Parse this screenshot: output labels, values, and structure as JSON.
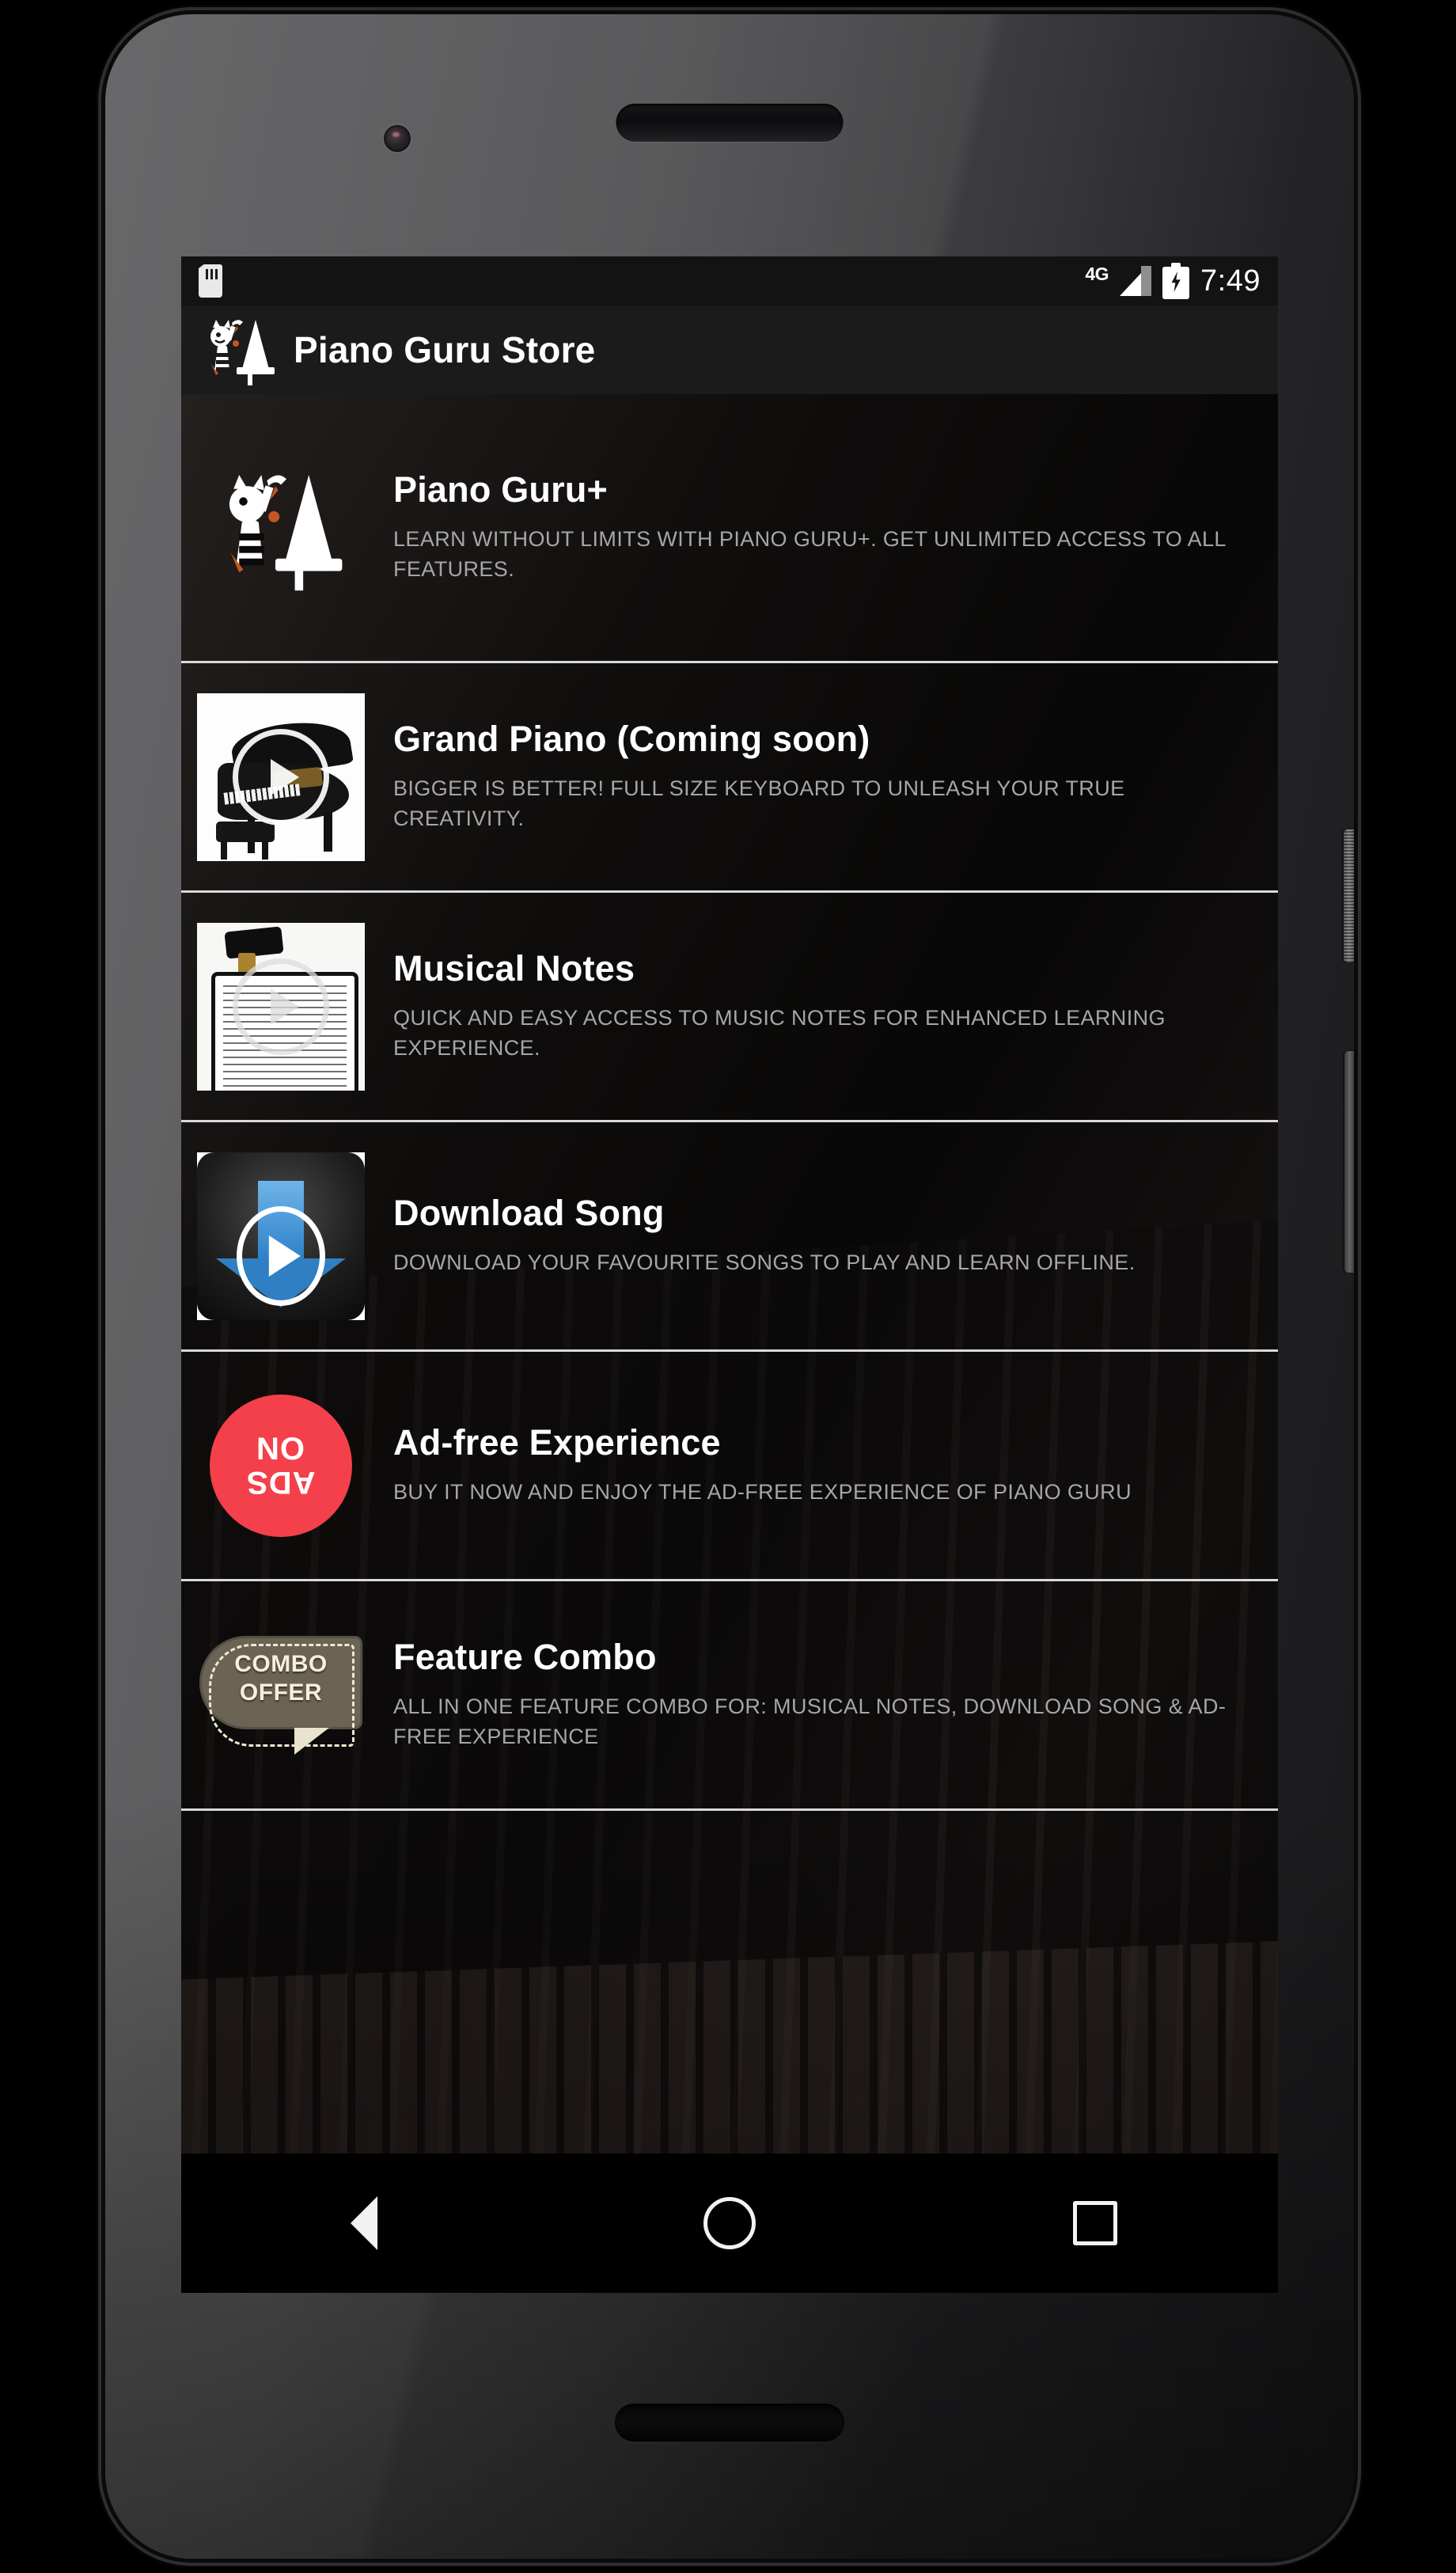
{
  "status_bar": {
    "sim_icon": "sim-card-icon",
    "network_label": "4G",
    "signal_icon": "signal-bars-icon",
    "battery_icon": "battery-charging-icon",
    "clock": "7:49"
  },
  "action_bar": {
    "logo_icon": "piano-guru-logo-icon",
    "title": "Piano Guru Store"
  },
  "store_items": [
    {
      "title": "Piano Guru+",
      "description": "LEARN WITHOUT LIMITS WITH PIANO GURU+. GET UNLIMITED ACCESS TO ALL FEATURES.",
      "thumb": "piano-guru-logo-icon"
    },
    {
      "title": "Grand Piano (Coming soon)",
      "description": "BIGGER IS BETTER! FULL SIZE KEYBOARD TO UNLEASH YOUR TRUE CREATIVITY.",
      "thumb": "grand-piano-video-thumbnail"
    },
    {
      "title": "Musical Notes",
      "description": "QUICK AND EASY ACCESS TO MUSIC NOTES FOR ENHANCED LEARNING EXPERIENCE.",
      "thumb": "musical-notes-video-thumbnail"
    },
    {
      "title": "Download Song",
      "description": "DOWNLOAD YOUR FAVOURITE SONGS TO PLAY AND LEARN OFFLINE.",
      "thumb": "download-song-icon"
    },
    {
      "title": "Ad-free Experience",
      "description": "BUY IT NOW AND ENJOY THE AD-FREE EXPERIENCE OF PIANO GURU",
      "thumb": "no-ads-badge-icon",
      "badge_line1": "NO",
      "badge_line2": "ADS"
    },
    {
      "title": "Feature Combo",
      "description": "ALL IN ONE FEATURE COMBO FOR: MUSICAL NOTES, DOWNLOAD SONG & AD-FREE EXPERIENCE",
      "thumb": "combo-offer-badge-icon",
      "badge_line1": "COMBO",
      "badge_line2": "OFFER"
    }
  ],
  "nav_bar": {
    "back": "back-icon",
    "home": "home-icon",
    "recents": "recents-icon"
  },
  "colors": {
    "accent_red": "#f4404a",
    "accent_blue": "#2f7fc2",
    "combo_tag": "#6b6354",
    "divider": "#d9d9d9",
    "title_text": "#ffffff",
    "desc_text": "#a6a6a6",
    "action_bar_bg": "#1b1b1c",
    "status_bar_bg": "#131314"
  }
}
